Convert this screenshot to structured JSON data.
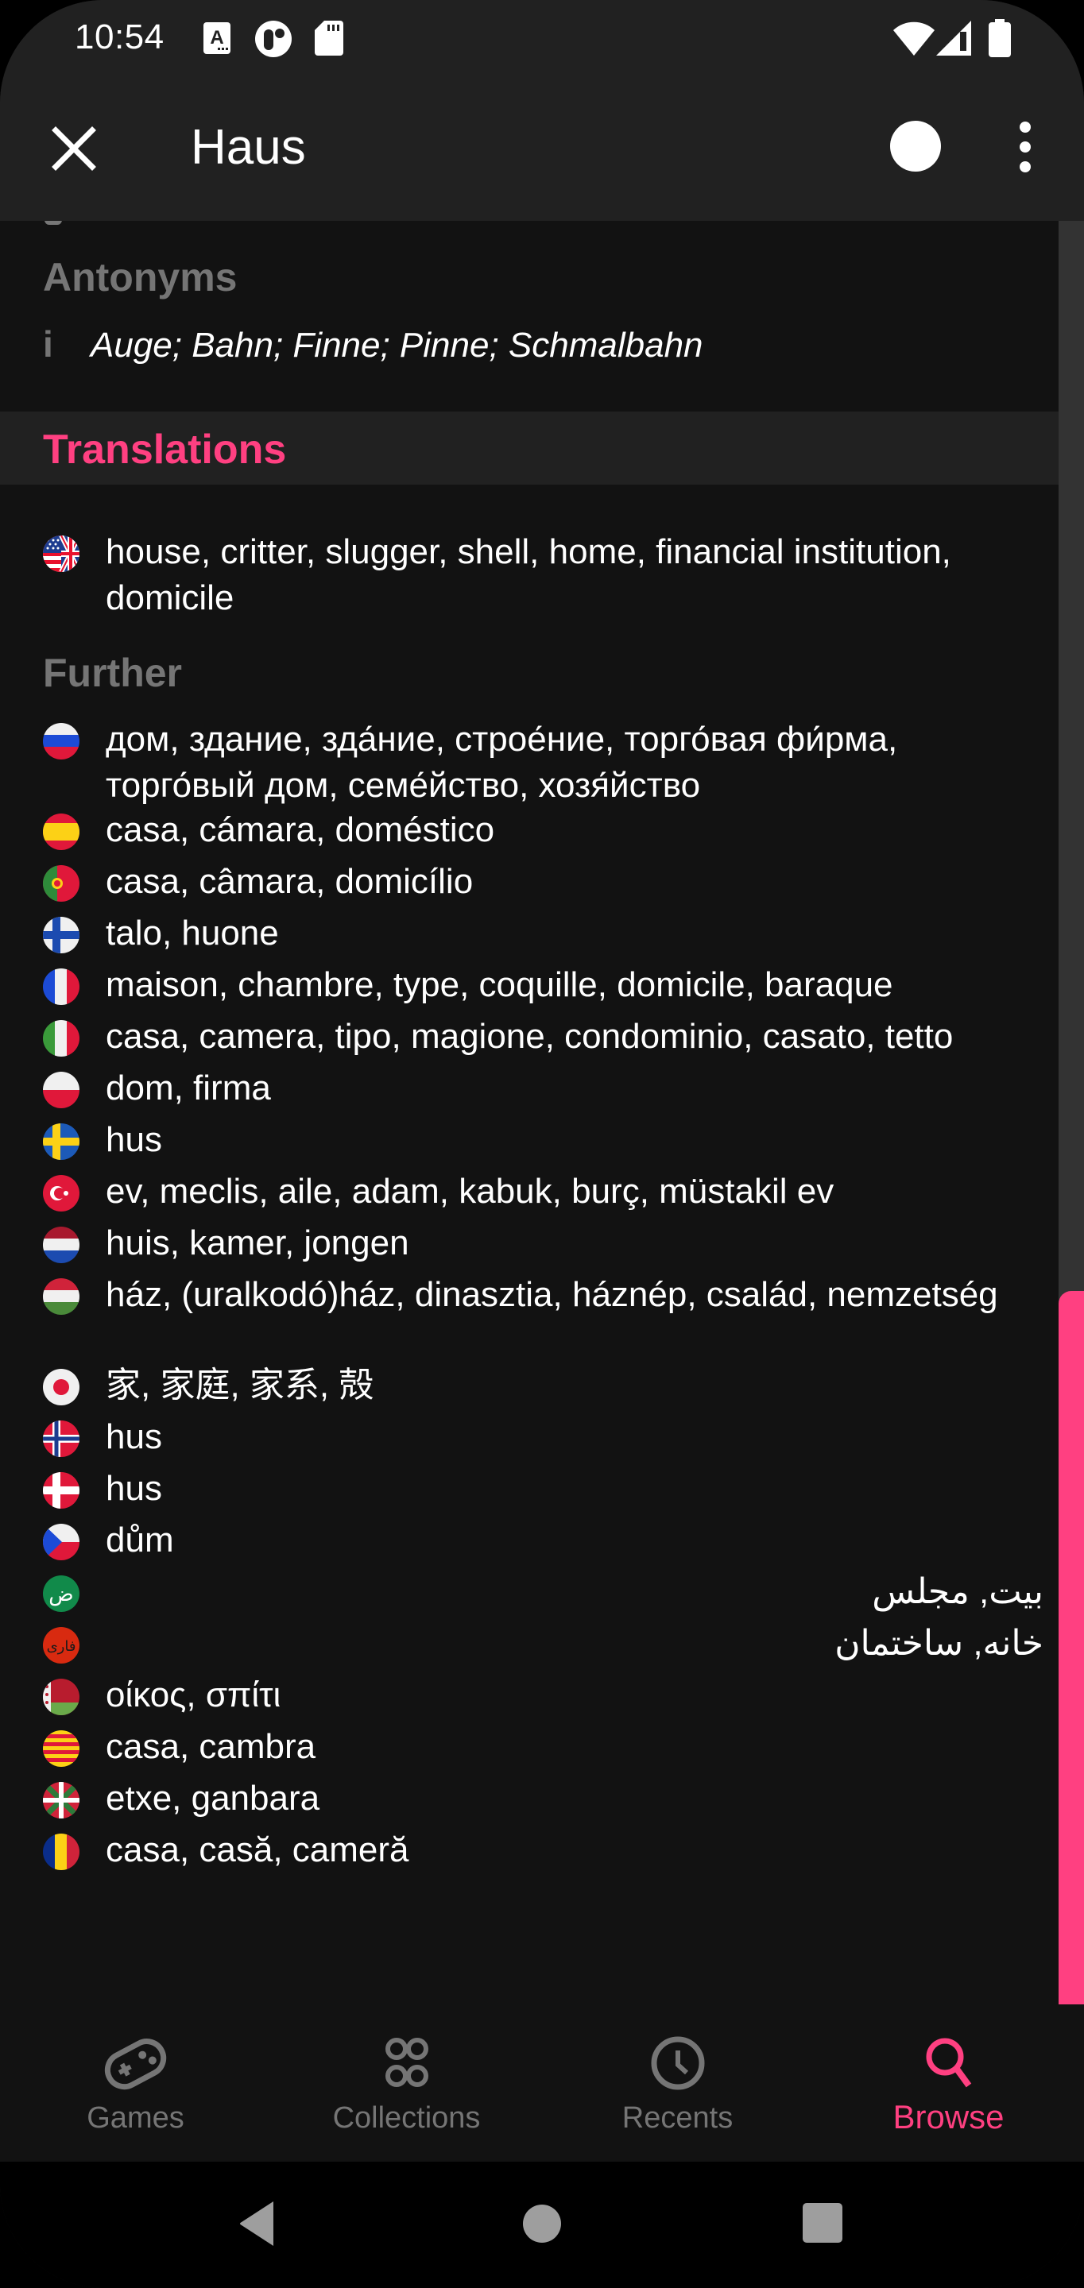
{
  "status_bar": {
    "time": "10:54",
    "left_icons": [
      "font-a-icon",
      "app-notification-icon",
      "sd-card-icon"
    ],
    "right_icons": [
      "wifi-icon",
      "cell-signal-icon",
      "battery-icon"
    ]
  },
  "app_bar": {
    "title": "Haus",
    "close_icon": "close-icon",
    "action_icon": "circle-icon",
    "menu_icon": "more-vert-icon"
  },
  "antonyms": {
    "label": "Antonyms",
    "index": "i",
    "text": "Auge; Bahn; Finne; Pinne; Schmalbahn"
  },
  "translations": {
    "header": "Translations",
    "primary": [
      {
        "flag": "us-gb",
        "text": "house, critter, slugger, shell, home, financial institution, domicile"
      }
    ],
    "further_label": "Further",
    "further": [
      {
        "flag": "ru",
        "text": "дом, здание, зда́ние, строе́ние, торго́вая фи́рма, торго́вый дом, семе́йство, хозя́йство"
      },
      {
        "flag": "es",
        "text": "casa, cámara, doméstico"
      },
      {
        "flag": "pt",
        "text": "casa, câmara, domicílio"
      },
      {
        "flag": "fi",
        "text": "talo, huone"
      },
      {
        "flag": "fr",
        "text": "maison, chambre, type, coquille, domicile, baraque"
      },
      {
        "flag": "it",
        "text": "casa, camera, tipo, magione, condominio, casato, tetto"
      },
      {
        "flag": "pl",
        "text": "dom, firma"
      },
      {
        "flag": "se",
        "text": "hus"
      },
      {
        "flag": "tr",
        "text": "ev, meclis, aile, adam, kabuk, burç, müstakil ev"
      },
      {
        "flag": "nl",
        "text": "huis, kamer, jongen"
      },
      {
        "flag": "hu",
        "text": "ház, (uralkodó)ház, dinasztia, háznép, család, nemzetség"
      },
      {
        "flag": "jp",
        "text": "家, 家庭, 家系, 殻"
      },
      {
        "flag": "no",
        "text": "hus"
      },
      {
        "flag": "dk",
        "text": "hus"
      },
      {
        "flag": "cz",
        "text": "dům"
      },
      {
        "flag": "ar",
        "text": "بيت, مجلس",
        "rtl": true
      },
      {
        "flag": "fa",
        "text": "خانه, ساختمان",
        "rtl": true
      },
      {
        "flag": "gr",
        "text": "οίκος, σπίτι"
      },
      {
        "flag": "ca",
        "text": "casa, cambra"
      },
      {
        "flag": "eu",
        "text": "etxe, ganbara"
      },
      {
        "flag": "ro",
        "text": "casa, casă, cameră"
      }
    ]
  },
  "pager": {
    "pages": 3,
    "current": 2
  },
  "scroll": {
    "thumb_start_fraction": 0.6,
    "thumb_end_fraction": 1.0
  },
  "bottom_nav": [
    {
      "label": "Games",
      "icon": "gamepad-icon",
      "active": false
    },
    {
      "label": "Collections",
      "icon": "collections-icon",
      "active": false
    },
    {
      "label": "Recents",
      "icon": "clock-icon",
      "active": false
    },
    {
      "label": "Browse",
      "icon": "search-icon",
      "active": true
    }
  ],
  "system_nav": [
    "back-icon",
    "home-icon",
    "recents-icon"
  ],
  "colors": {
    "accent": "#ff4081",
    "surface": "#212121",
    "background": "#121212",
    "muted": "#757575"
  }
}
